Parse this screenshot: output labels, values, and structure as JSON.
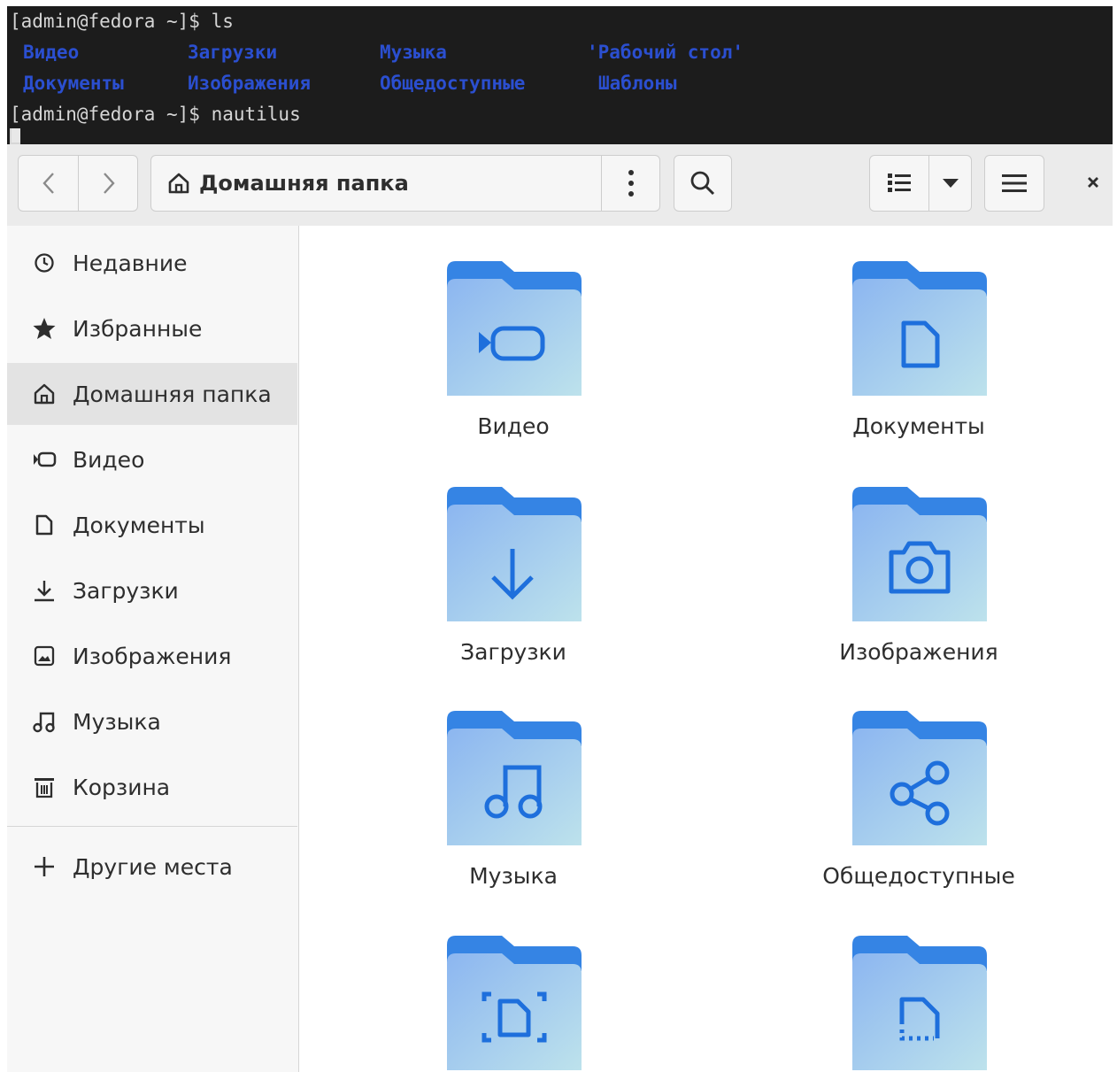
{
  "terminal": {
    "prompt1": "[admin@fedora ~]$ ls",
    "listing": [
      "Видео",
      "Загрузки",
      "Музыка",
      "'Рабочий стол'",
      "Документы",
      "Изображения",
      "Общедоступные",
      "Шаблоны"
    ],
    "prompt2": "[admin@fedora ~]$ nautilus",
    "dir_color": "#2b4fd0"
  },
  "headerbar": {
    "back_icon": "chevron-left-icon",
    "forward_icon": "chevron-right-icon",
    "path_label": "Домашняя папка",
    "path_icon": "home-icon",
    "path_menu_icon": "vertical-dots-icon",
    "search_icon": "search-icon",
    "view_icon": "list-view-icon",
    "view_dropdown_icon": "triangle-down-icon",
    "menu_icon": "hamburger-icon",
    "close_icon": "close-icon"
  },
  "sidebar": {
    "items": [
      {
        "label": "Недавние",
        "icon": "clock-icon"
      },
      {
        "label": "Избранные",
        "icon": "star-icon"
      },
      {
        "label": "Домашняя папка",
        "icon": "home-icon",
        "active": true
      },
      {
        "label": "Видео",
        "icon": "video-icon"
      },
      {
        "label": "Документы",
        "icon": "document-icon"
      },
      {
        "label": "Загрузки",
        "icon": "download-icon"
      },
      {
        "label": "Изображения",
        "icon": "image-icon"
      },
      {
        "label": "Музыка",
        "icon": "music-icon"
      },
      {
        "label": "Корзина",
        "icon": "trash-icon"
      }
    ],
    "other": {
      "label": "Другие места",
      "icon": "plus-icon"
    }
  },
  "folders": [
    {
      "name": "Видео",
      "icon": "video-icon"
    },
    {
      "name": "Документы",
      "icon": "document-icon"
    },
    {
      "name": "Загрузки",
      "icon": "download-icon"
    },
    {
      "name": "Изображения",
      "icon": "camera-icon"
    },
    {
      "name": "Музыка",
      "icon": "music-icon"
    },
    {
      "name": "Общедоступные",
      "icon": "share-icon"
    },
    {
      "name": "",
      "icon": "desktop-icon"
    },
    {
      "name": "",
      "icon": "template-icon"
    }
  ],
  "colors": {
    "folder_tab": "#3584e4",
    "folder_body_top": "#8cb6f0",
    "folder_body_bottom": "#bde2ec",
    "folder_symbol": "#1e6fdc"
  }
}
